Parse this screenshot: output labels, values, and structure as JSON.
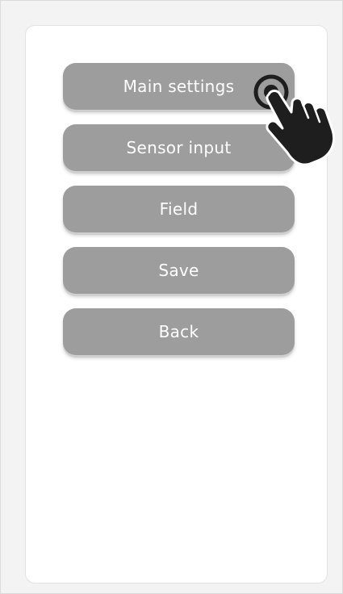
{
  "menu": {
    "items": [
      {
        "label": "Main settings"
      },
      {
        "label": "Sensor input"
      },
      {
        "label": "Field"
      },
      {
        "label": "Save"
      },
      {
        "label": "Back"
      }
    ]
  },
  "icons": {
    "pointer": "pointing-hand-click-icon"
  },
  "colors": {
    "button_bg": "#9d9d9d",
    "button_text": "#ffffff",
    "panel_bg": "#ffffff",
    "page_bg": "#f3f3f3"
  }
}
